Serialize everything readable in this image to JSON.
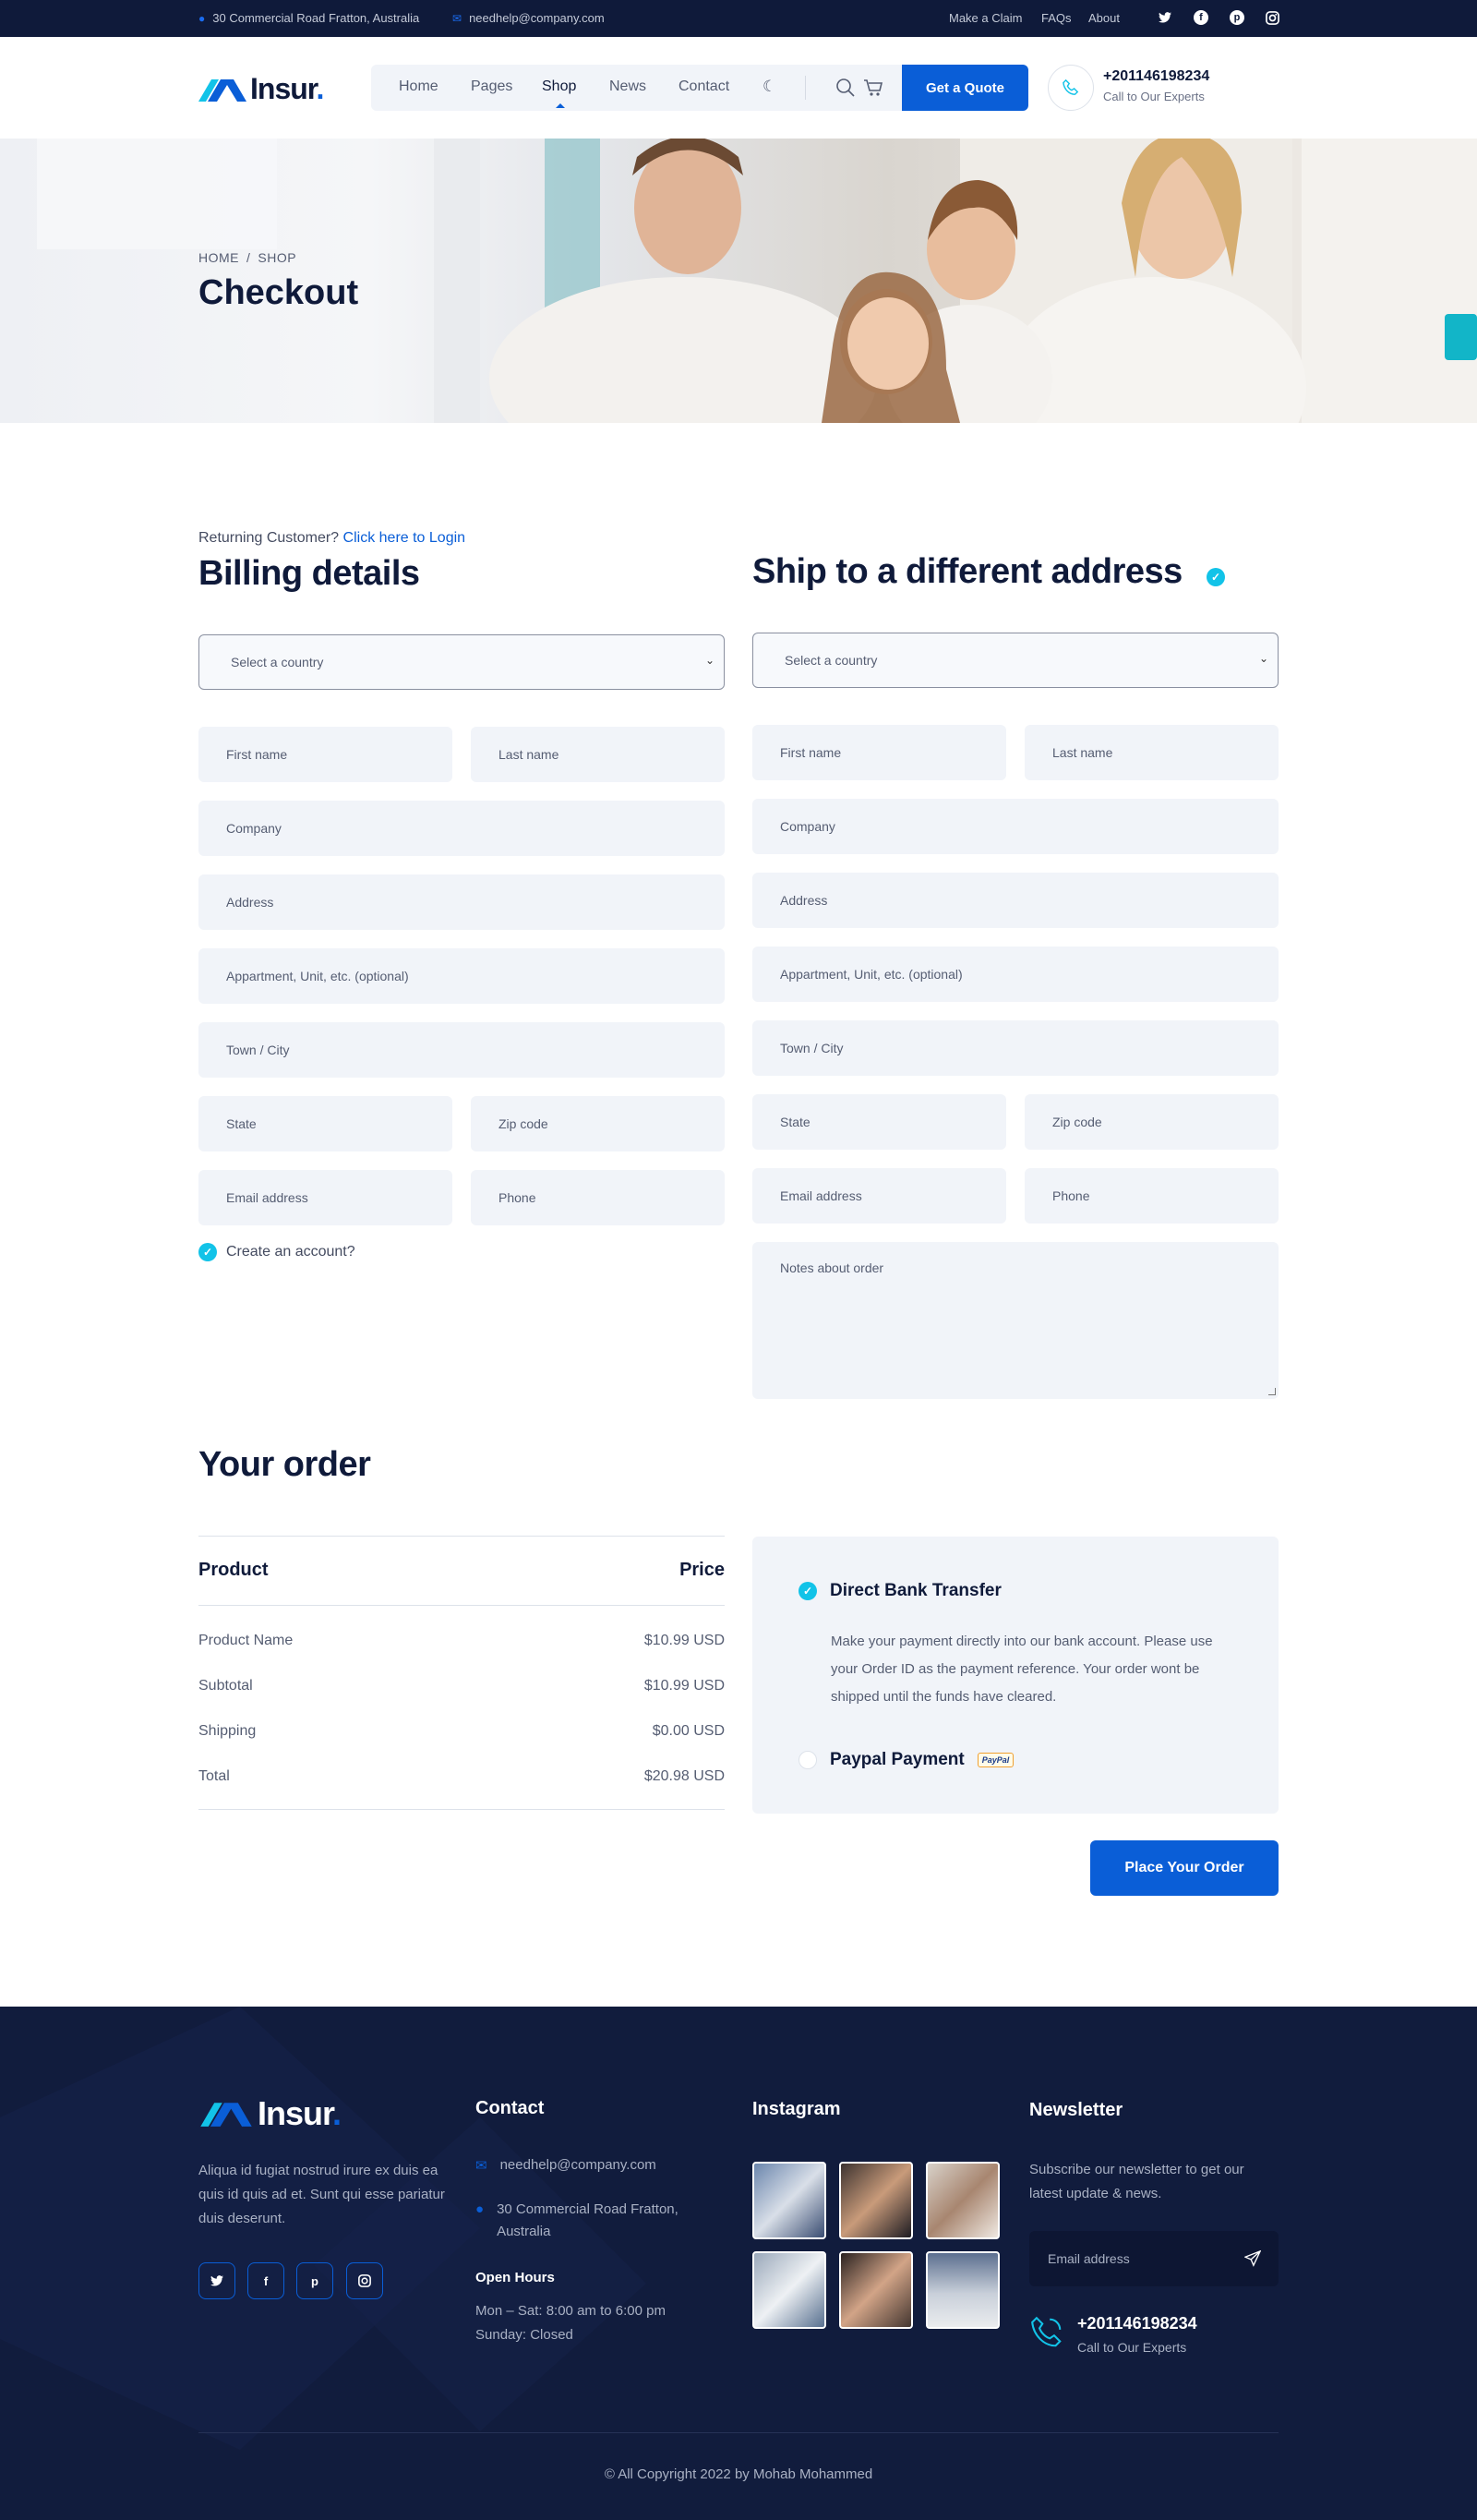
{
  "topbar": {
    "address": "30 Commercial Road Fratton, Australia",
    "email": "needhelp@company.com",
    "links": [
      "Make a Claim",
      "FAQs",
      "About"
    ],
    "social": [
      "twitter-icon",
      "facebook-icon",
      "pinterest-icon",
      "instagram-icon"
    ]
  },
  "header": {
    "logo": "Insur",
    "logo_dot": ".",
    "nav": [
      "Home",
      "Pages",
      "Shop",
      "News",
      "Contact"
    ],
    "active_nav": "Shop",
    "quote_label": "Get a Quote",
    "phone": "+201146198234",
    "phone_sub": "Call to Our Experts"
  },
  "hero": {
    "breadcrumb_home": "HOME",
    "breadcrumb_sep": "/",
    "breadcrumb_current": "SHOP",
    "title": "Checkout"
  },
  "billing": {
    "returning_text": "Returning Customer?",
    "login_link": "Click here to Login",
    "title": "Billing details",
    "country_placeholder": "Select a country",
    "first_name": "First name",
    "last_name": "Last name",
    "company": "Company",
    "address": "Address",
    "apartment": "Appartment, Unit, etc. (optional)",
    "town": "Town / City",
    "state": "State",
    "zip": "Zip code",
    "email": "Email address",
    "phone": "Phone",
    "create_account": "Create an account?"
  },
  "shipping": {
    "title": "Ship to a different address",
    "country_placeholder": "Select a country",
    "first_name": "First name",
    "last_name": "Last name",
    "company": "Company",
    "address": "Address",
    "apartment": "Appartment, Unit, etc. (optional)",
    "town": "Town / City",
    "state": "State",
    "zip": "Zip code",
    "email": "Email address",
    "phone": "Phone",
    "notes": "Notes about order"
  },
  "order": {
    "title": "Your order",
    "col_product": "Product",
    "col_price": "Price",
    "rows": [
      {
        "label": "Product Name",
        "value": "$10.99 USD"
      },
      {
        "label": "Subtotal",
        "value": "$10.99 USD"
      },
      {
        "label": "Shipping",
        "value": "$0.00 USD"
      },
      {
        "label": "Total",
        "value": "$20.98 USD"
      }
    ]
  },
  "payment": {
    "bank_label": "Direct Bank Transfer",
    "bank_desc": "Make your payment directly into our bank account. Please use your Order ID as the payment reference. Your order wont be shipped until the funds have cleared.",
    "paypal_label": "Paypal Payment",
    "paypal_badge": "PayPal",
    "place_order": "Place Your Order"
  },
  "footer": {
    "logo": "Insur",
    "logo_dot": ".",
    "about": "Aliqua id fugiat nostrud irure ex duis ea quis id quis ad et. Sunt qui esse pariatur duis deserunt.",
    "contact_title": "Contact",
    "contact_email": "needhelp@company.com",
    "contact_address": "30 Commercial Road Fratton, Australia",
    "hours_title": "Open Hours",
    "hours_weekday": "Mon – Sat: 8:00 am to 6:00 pm",
    "hours_sunday": "Sunday: Closed",
    "instagram_title": "Instagram",
    "newsletter_title": "Newsletter",
    "newsletter_text": "Subscribe our newsletter to get our latest update & news.",
    "newsletter_placeholder": "Email address",
    "phone": "+201146198234",
    "phone_sub": "Call to Our Experts",
    "copyright": "© All Copyright 2022 by Mohab Mohammed"
  },
  "colors": {
    "brand": "#0a5ed7",
    "accent": "#12c3e8",
    "dark": "#0f1a3a"
  }
}
